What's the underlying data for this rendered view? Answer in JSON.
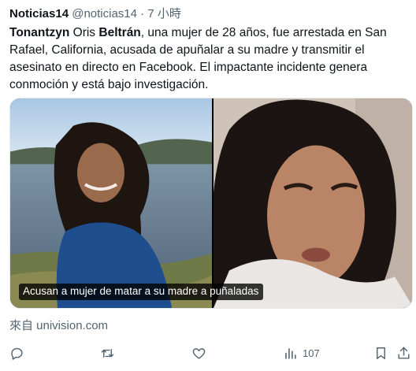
{
  "tweet": {
    "author_name": "Noticias14",
    "handle": "@noticias14",
    "separator": "·",
    "time": "7 小時",
    "text": {
      "first_name": "Tonantzyn",
      "middle": " Oris ",
      "last_name": "Beltrán",
      "rest": ", una mujer de 28 años, fue arrestada en San Rafael, California, acusada de apuñalar a su madre y transmitir el asesinato en directo en Facebook. El impactante incidente genera conmoción y está bajo investigación."
    },
    "media": {
      "caption": "Acusan a mujer de matar a su madre a puñaladas"
    },
    "source": "來自 univision.com"
  },
  "actions": {
    "reply_icon": "reply-icon",
    "repost_icon": "repost-icon",
    "like_icon": "heart-icon",
    "views_icon": "bar-chart-icon",
    "views_count": "107",
    "bookmark_icon": "bookmark-icon",
    "share_icon": "share-icon"
  },
  "colors": {
    "text": "#0f1419",
    "secondary": "#536471"
  }
}
